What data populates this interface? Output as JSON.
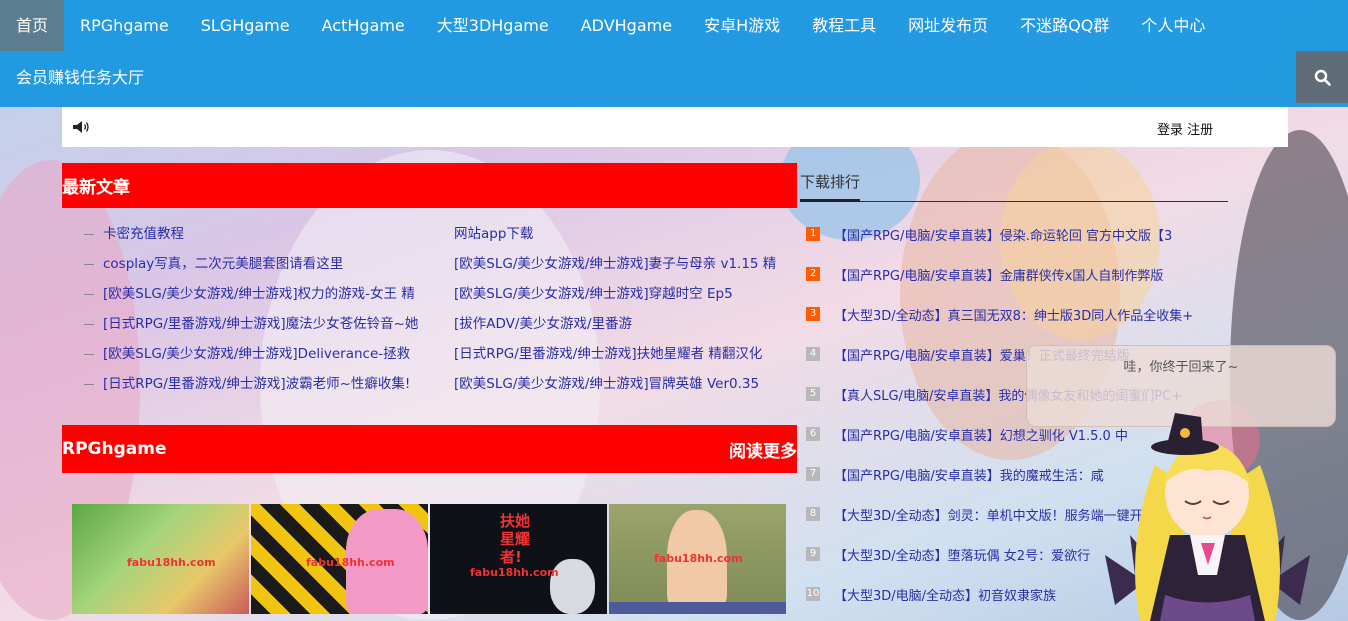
{
  "nav": {
    "items": [
      {
        "label": "首页",
        "active": true
      },
      {
        "label": "RPGhgame"
      },
      {
        "label": "SLGHgame"
      },
      {
        "label": "ActHgame"
      },
      {
        "label": "大型3DHgame"
      },
      {
        "label": "ADVHgame"
      },
      {
        "label": "安卓H游戏"
      },
      {
        "label": "教程工具"
      },
      {
        "label": "网址发布页"
      },
      {
        "label": "不迷路QQ群"
      },
      {
        "label": "个人中心"
      }
    ],
    "row2_label": "会员赚钱任务大厅",
    "search_icon": "search-icon"
  },
  "notice": {
    "icon": "speaker-icon",
    "login_label": "登录",
    "register_label": "注册"
  },
  "latest": {
    "title": "最新文章",
    "left": [
      "卡密充值教程",
      "cosplay写真，二次元美腿套图请看这里",
      "[欧美SLG/美少女游戏/绅士游戏]权力的游戏-女王 精",
      "[日式RPG/里番游戏/绅士游戏]魔法少女苍佐铃音~她",
      "[欧美SLG/美少女游戏/绅士游戏]Deliverance-拯救",
      "[日式RPG/里番游戏/绅士游戏]波霸老师~性癖收集!"
    ],
    "right": [
      "网站app下载",
      "[欧美SLG/美少女游戏/绅士游戏]妻子与母亲 v1.15 精",
      "[欧美SLG/美少女游戏/绅士游戏]穿越时空 Ep5",
      "[拔作ADV/美少女游戏/里番游",
      "[日式RPG/里番游戏/绅士游戏]扶她星耀者 精翻汉化",
      "[欧美SLG/美少女游戏/绅士游戏]冒牌英雄 Ver0.35"
    ]
  },
  "rpg_section": {
    "title": "RPGhgame",
    "more_label": "阅读更多",
    "thumbs": [
      {
        "watermark": "fabu18hh.com"
      },
      {
        "watermark": "fabu18hh.com"
      },
      {
        "watermark": "fabu18hh.com",
        "title": "扶她 星耀者!"
      },
      {
        "watermark": "fabu18hh.com"
      }
    ]
  },
  "ranking": {
    "title": "下载排行",
    "items": [
      {
        "num": "1",
        "text": "【国产RPG/电脑/安卓直装】侵染.命运轮回 官方中文版【3"
      },
      {
        "num": "2",
        "text": "【国产RPG/电脑/安卓直装】金庸群侠传x国人自制作弊版"
      },
      {
        "num": "3",
        "text": "【大型3D/全动态】真三国无双8：绅士版3D同人作品全收集+"
      },
      {
        "num": "4",
        "text": "【国产RPG/电脑/安卓直装】爱巢！正式最终完结版"
      },
      {
        "num": "5",
        "text": "【真人SLG/电脑/安卓直装】我的偶像女友和她的闺蜜们PC+"
      },
      {
        "num": "6",
        "text": "【国产RPG/电脑/安卓直装】幻想之驯化 V1.5.0 中"
      },
      {
        "num": "7",
        "text": "【国产RPG/电脑/安卓直装】我的魔戒生活：咸"
      },
      {
        "num": "8",
        "text": "【大型3D/全动态】剑灵：单机中文版！服务端一键开"
      },
      {
        "num": "9",
        "text": "【大型3D/全动态】堕落玩偶 女2号：爱欲行"
      },
      {
        "num": "10",
        "text": "【大型3D/电脑/全动态】初音奴隶家族"
      }
    ]
  },
  "mascot": {
    "greeting": "哇，你终于回来了~"
  },
  "colors": {
    "nav_bg": "#1496e1",
    "section_red": "#ff0000",
    "rank_top": "#ff5c00",
    "link_blue": "#2a2ea8"
  }
}
